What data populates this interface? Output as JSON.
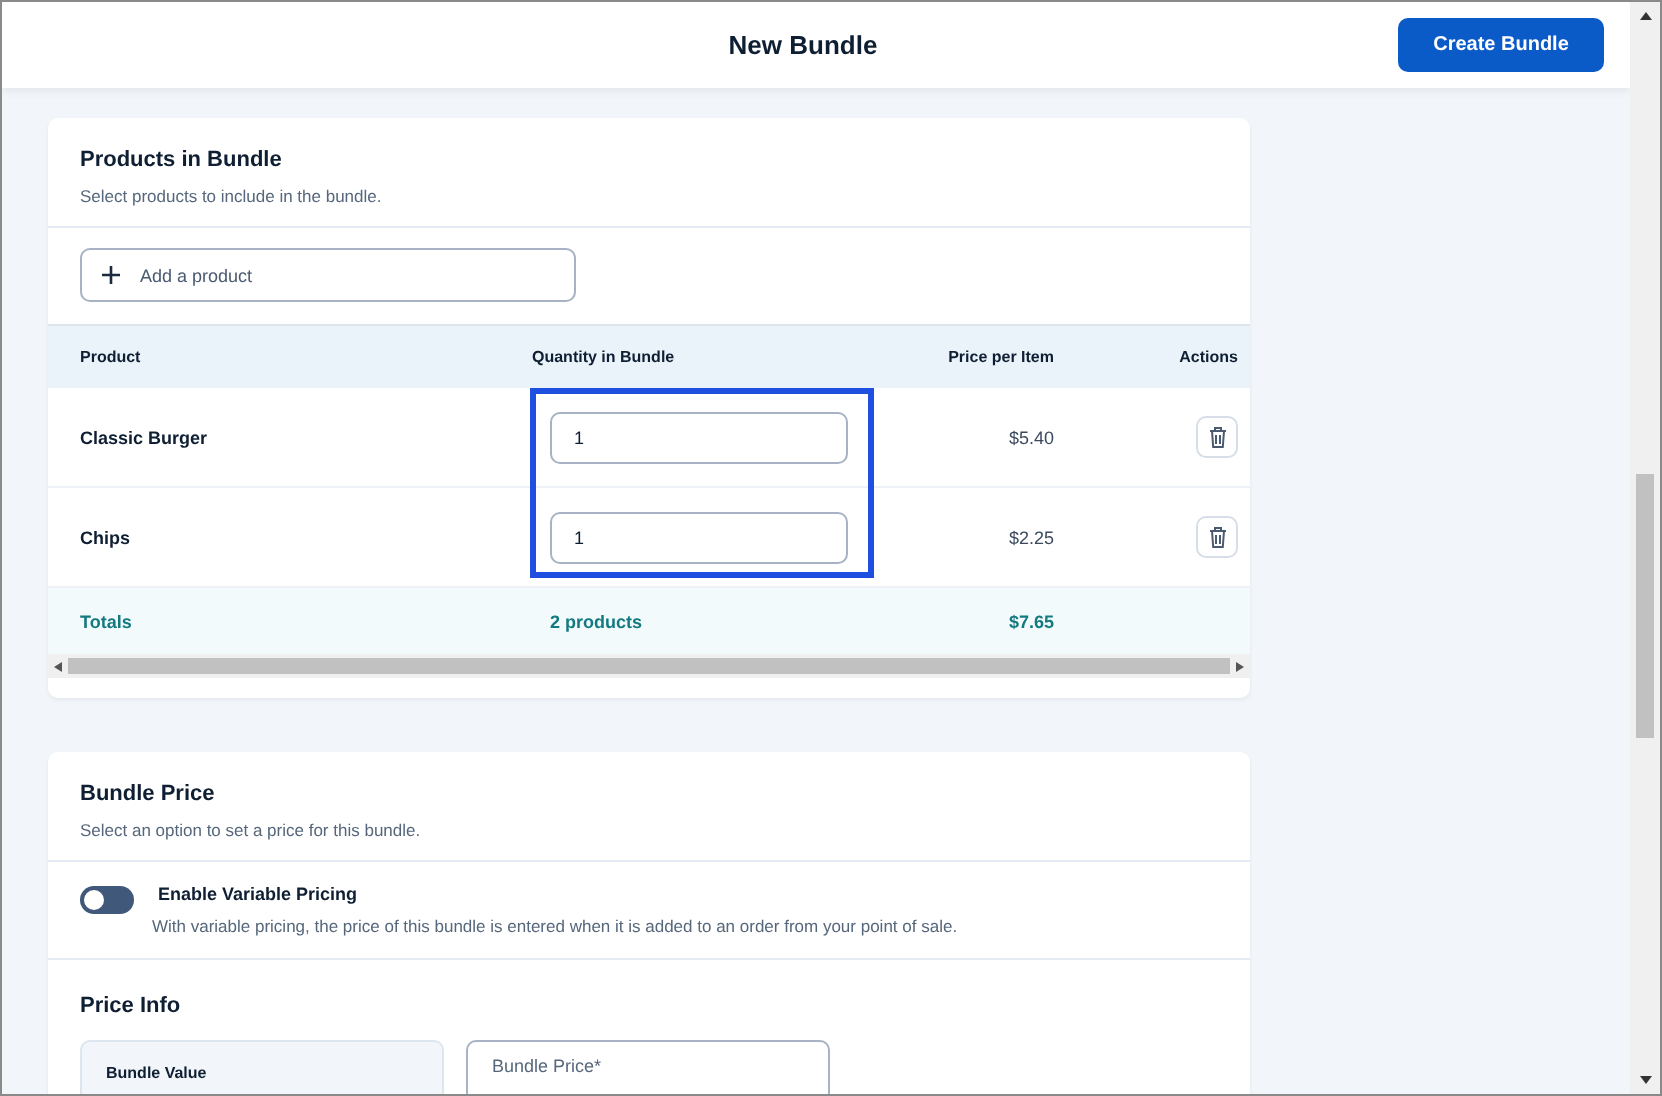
{
  "header": {
    "title": "New Bundle",
    "primary_button": "Create Bundle"
  },
  "products_card": {
    "title": "Products in Bundle",
    "subtitle": "Select products to include in the bundle.",
    "add_field": {
      "placeholder": "Add a product"
    },
    "table": {
      "columns": [
        "Product",
        "Quantity in Bundle",
        "Price per Item",
        "Actions"
      ],
      "rows": [
        {
          "product": "Classic Burger",
          "quantity": "1",
          "price": "$5.40"
        },
        {
          "product": "Chips",
          "quantity": "1",
          "price": "$2.25"
        }
      ],
      "totals": {
        "label": "Totals",
        "quantity": "2 products",
        "price": "$7.65"
      }
    }
  },
  "price_card": {
    "title": "Bundle Price",
    "subtitle": "Select an option to set a price for this bundle.",
    "toggle": {
      "label": "Enable Variable Pricing",
      "description": "With variable pricing, the price of this bundle is entered when it is added to an order from your point of sale.",
      "on": false
    },
    "section_title": "Price Info",
    "value_box": {
      "label": "Bundle Value"
    },
    "price_field": {
      "placeholder": "Bundle Price*"
    }
  }
}
